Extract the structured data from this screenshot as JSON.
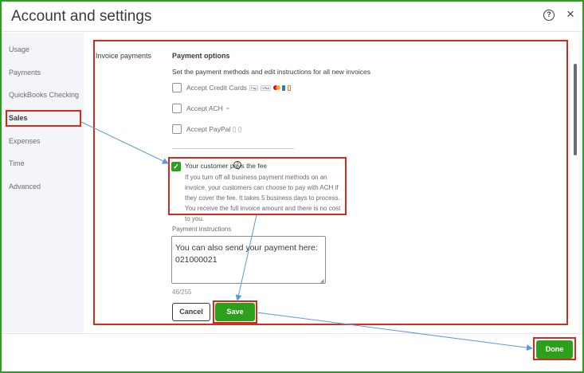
{
  "header": {
    "title": "Account and settings",
    "help_icon": "?",
    "close_icon": "×"
  },
  "sidebar": {
    "items": [
      {
        "label": "Usage"
      },
      {
        "label": "Payments"
      },
      {
        "label": "QuickBooks Checking"
      },
      {
        "label": "Sales",
        "active": true
      },
      {
        "label": "Expenses"
      },
      {
        "label": "Time"
      },
      {
        "label": "Advanced"
      }
    ]
  },
  "main": {
    "section_label": "Invoice payments",
    "options_title": "Payment options",
    "options_desc": "Set the payment methods and edit instructions for all new invoices",
    "methods": [
      {
        "label": "Accept Credit Cards",
        "checked": false,
        "logos": [
          "Pay",
          "VISA",
          "mastercard",
          "amex",
          "discover"
        ]
      },
      {
        "label": "Accept ACH",
        "checked": false,
        "logos": [
          "bank"
        ]
      },
      {
        "label": "Accept PayPal",
        "checked": false,
        "logos": [
          "PayPal",
          "venmo"
        ]
      }
    ],
    "fee": {
      "checked": true,
      "check_glyph": "✓",
      "label": "Your customer pays the fee",
      "info_icon": "?",
      "text": "If you turn off all business payment methods on an invoice, your customers can choose to pay with ACH if they cover the fee. It takes 5 business days to process. You receive the full invoice amount and there is no cost to you."
    },
    "payment_instructions": {
      "label": "Payment instructions",
      "value": "You can also send your payment here:\n021000021",
      "counter": "46/255"
    },
    "buttons": {
      "cancel": "Cancel",
      "save": "Save"
    }
  },
  "footer": {
    "done": "Done"
  },
  "colors": {
    "accent": "#2ca01c",
    "annotation": "#d52b1e",
    "arrow": "#5b9bd5"
  }
}
